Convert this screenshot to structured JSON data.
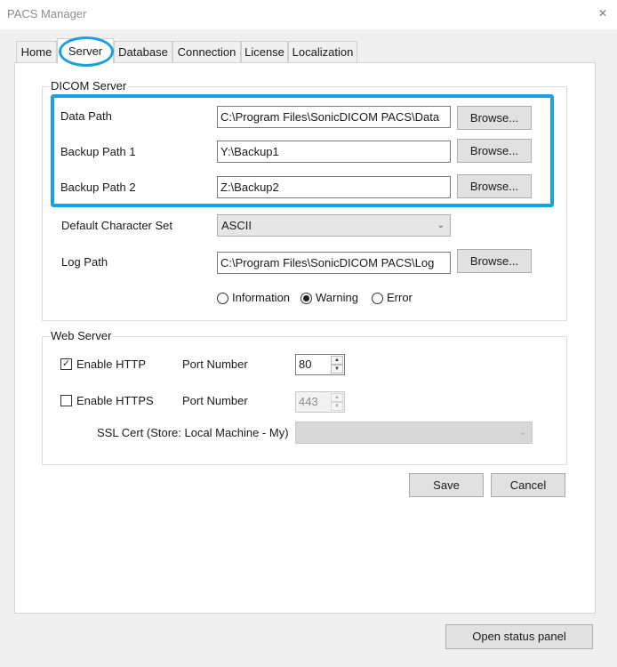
{
  "window": {
    "title": "PACS Manager",
    "close_glyph": "✕"
  },
  "tabs": [
    {
      "label": "Home",
      "active": false
    },
    {
      "label": "Server",
      "active": true
    },
    {
      "label": "Database",
      "active": false
    },
    {
      "label": "Connection",
      "active": false
    },
    {
      "label": "License",
      "active": false
    },
    {
      "label": "Localization",
      "active": false
    }
  ],
  "dicom": {
    "group_title": "DICOM Server",
    "data_path": {
      "label": "Data Path",
      "value": "C:\\Program Files\\SonicDICOM PACS\\Data",
      "button": "Browse..."
    },
    "backup1": {
      "label": "Backup Path 1",
      "value": "Y:\\Backup1",
      "button": "Browse..."
    },
    "backup2": {
      "label": "Backup Path 2",
      "value": "Z:\\Backup2",
      "button": "Browse..."
    },
    "charset": {
      "label": "Default Character Set",
      "value": "ASCII"
    },
    "log_path": {
      "label": "Log Path",
      "value": "C:\\Program Files\\SonicDICOM PACS\\Log",
      "button": "Browse..."
    },
    "log_level": {
      "options": [
        "Information",
        "Warning",
        "Error"
      ],
      "selected": "Warning"
    }
  },
  "web": {
    "group_title": "Web Server",
    "http": {
      "label": "Enable HTTP",
      "checked": true,
      "port_label": "Port Number",
      "port": "80"
    },
    "https": {
      "label": "Enable HTTPS",
      "checked": false,
      "port_label": "Port Number",
      "port": "443"
    },
    "ssl": {
      "label": "SSL Cert (Store: Local Machine - My)",
      "value": ""
    }
  },
  "actions": {
    "save": "Save",
    "cancel": "Cancel",
    "status": "Open status panel"
  },
  "icons": {
    "check": "✓",
    "dropdown": "⌄",
    "spin_up": "▲",
    "spin_down": "▼"
  },
  "colors": {
    "highlight": "#1aa0df",
    "window_bg": "#f0f0f0",
    "panel_bg": "#ffffff"
  }
}
